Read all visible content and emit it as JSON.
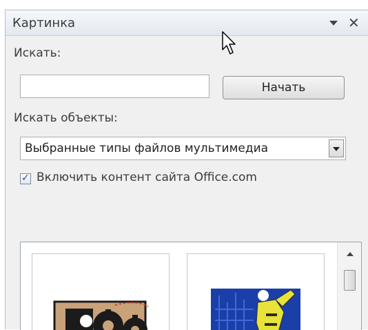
{
  "pane": {
    "title": "Картинка"
  },
  "search": {
    "label": "Искать:",
    "value": "",
    "placeholder": "",
    "go_button": "Начать"
  },
  "results_filter": {
    "label": "Искать объекты:",
    "selected": "Выбранные типы файлов мультимедиа"
  },
  "include_office": {
    "label": "Включить контент сайта Office.com",
    "checked": true
  },
  "results": {
    "items": [
      {
        "icon": "gears-clipart-icon"
      },
      {
        "icon": "businessman-city-clipart-icon"
      }
    ]
  },
  "colors": {
    "pane_bg": "#f0f0f0",
    "check_color": "#2c4a84",
    "clipart_blue": "#1a3fa8",
    "clipart_yellow": "#e8e23a",
    "clipart_tan": "#c9a27a"
  }
}
